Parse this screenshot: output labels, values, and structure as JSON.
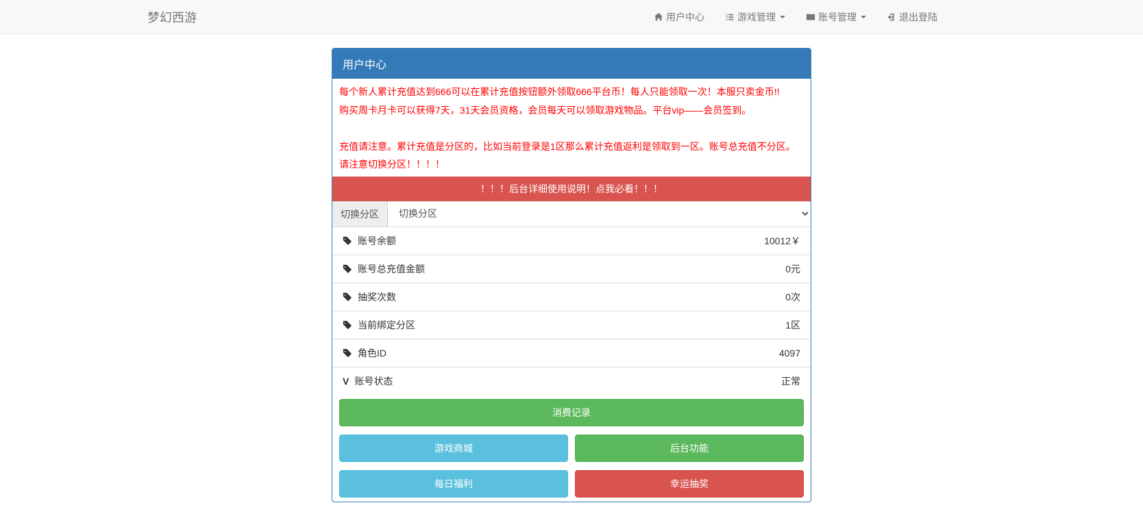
{
  "navbar": {
    "brand": "梦幻西游",
    "items": [
      {
        "label": "用户中心",
        "icon": "home"
      },
      {
        "label": "游戏管理",
        "icon": "list",
        "dropdown": true
      },
      {
        "label": "账号管理",
        "icon": "card",
        "dropdown": true
      },
      {
        "label": "退出登陆",
        "icon": "logout"
      }
    ]
  },
  "panel": {
    "title": "用户中心",
    "notice_line1": "每个新人累计充值达到666可以在累计充值按钮额外领取666平台币！每人只能领取一次！本服只卖金币!!",
    "notice_line2": "购买周卡月卡可以获得7天，31天会员资格，会员每天可以领取游戏物品。平台vip——会员签到。",
    "notice_line3": "充值请注意。累计充值是分区的，比如当前登录是1区那么累计充值返利是领取到一区。账号总充值不分区。请注意切换分区！！！！",
    "alert_text": "！！！后台详细使用说明！点我必看！！！",
    "zone_label": "切换分区",
    "zone_select": "切换分区",
    "info": [
      {
        "label": "账号余额",
        "value": "10012￥",
        "icon": "tag"
      },
      {
        "label": "账号总充值金额",
        "value": "0元",
        "icon": "tag"
      },
      {
        "label": "抽奖次数",
        "value": "0次",
        "icon": "tag"
      },
      {
        "label": "当前绑定分区",
        "value": "1区",
        "icon": "tag"
      },
      {
        "label": "角色ID",
        "value": "4097",
        "icon": "tag"
      },
      {
        "label": "账号状态",
        "value": "正常",
        "icon": "v"
      }
    ],
    "buttons": {
      "consume": "消费记录",
      "shop": "游戏商城",
      "backend": "后台功能",
      "daily": "每日福利",
      "lucky": "幸运抽奖"
    }
  }
}
